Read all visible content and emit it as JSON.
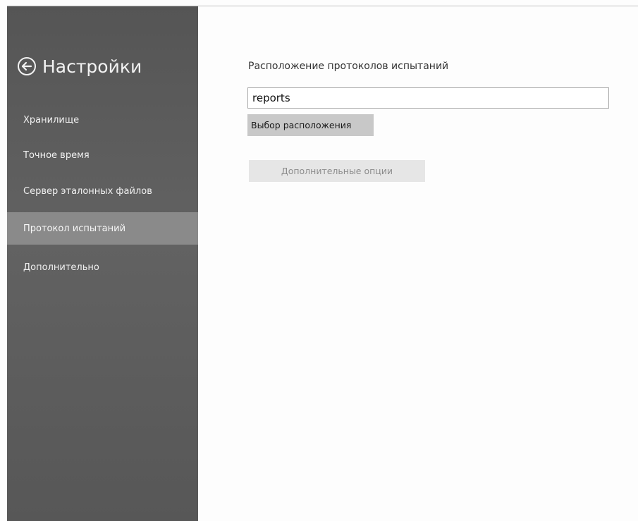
{
  "sidebar": {
    "title": "Настройки",
    "back_icon": "back-arrow-circle-icon",
    "items": [
      {
        "label": "Хранилище",
        "selected": false
      },
      {
        "label": "Точное время",
        "selected": false
      },
      {
        "label": "Сервер эталонных файлов",
        "selected": false
      },
      {
        "label": "Протокол испытаний",
        "selected": true
      },
      {
        "label": "Дополнительно",
        "selected": false
      }
    ]
  },
  "main": {
    "section_title": "Расположение протоколов испытаний",
    "path_value": "reports",
    "choose_button_label": "Выбор расположения",
    "options_button_label": "Дополнительные опции"
  }
}
